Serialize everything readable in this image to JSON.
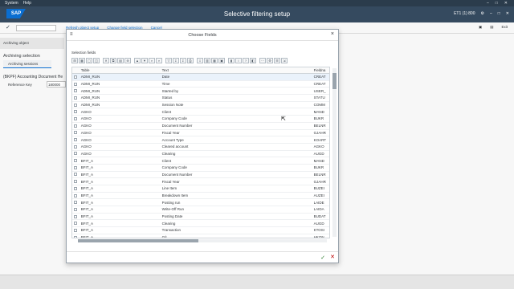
{
  "menubar": {
    "items": [
      "System",
      "Help"
    ]
  },
  "titlebar": {
    "logo": "SAP",
    "title": "Selective filtering setup",
    "system_info": "ET1 (1) 800"
  },
  "toolbar": {
    "links": [
      "Refresh object setup",
      "Change field selection",
      "Cancel"
    ],
    "right": [
      "Exit"
    ]
  },
  "background": {
    "tab": "Archiving object",
    "section": "Archiving selection",
    "subtab": "Archiving sessions",
    "doc": "(BKPF) Accounting Document He",
    "ref_label": "Reference Key",
    "ref_value": "180000"
  },
  "dialog": {
    "title": "Choose Fields",
    "section_label": "Selection fields",
    "columns": {
      "table": "Table",
      "text": "Text",
      "field": "Fieldna"
    },
    "rows": [
      {
        "table": "ADMI_RUN",
        "text": "Date",
        "field": "CREAT"
      },
      {
        "table": "ADMI_RUN",
        "text": "Time",
        "field": "CREAT"
      },
      {
        "table": "ADMI_RUN",
        "text": "Started by",
        "field": "USER_"
      },
      {
        "table": "ADMI_RUN",
        "text": "Status",
        "field": "STATU"
      },
      {
        "table": "ADMI_RUN",
        "text": "Session Note",
        "field": "COMM"
      },
      {
        "table": "AGKO",
        "text": "Client",
        "field": "MAND"
      },
      {
        "table": "AGKO",
        "text": "Company Code",
        "field": "BUKR"
      },
      {
        "table": "AGKO",
        "text": "Document Number",
        "field": "BELNR"
      },
      {
        "table": "AGKO",
        "text": "Fiscal Year",
        "field": "GJAHR"
      },
      {
        "table": "AGKO",
        "text": "Account Type",
        "field": "KOART"
      },
      {
        "table": "AGKO",
        "text": "Cleared account",
        "field": "AGKO"
      },
      {
        "table": "AGKO",
        "text": "Clearing",
        "field": "AUGD"
      },
      {
        "table": "BFIT_A",
        "text": "Client",
        "field": "MAND"
      },
      {
        "table": "BFIT_A",
        "text": "Company Code",
        "field": "BUKR"
      },
      {
        "table": "BFIT_A",
        "text": "Document Number",
        "field": "BELNR"
      },
      {
        "table": "BFIT_A",
        "text": "Fiscal Year",
        "field": "GJAHR"
      },
      {
        "table": "BFIT_A",
        "text": "Line Item",
        "field": "BUZEI"
      },
      {
        "table": "BFIT_A",
        "text": "Breakdown Item",
        "field": "AUZEI"
      },
      {
        "table": "BFIT_A",
        "text": "Posting run",
        "field": "LAIDE"
      },
      {
        "table": "BFIT_A",
        "text": "Write-Off Run",
        "field": "LAIDA"
      },
      {
        "table": "BFIT_A",
        "text": "Posting Date",
        "field": "BUDAT"
      },
      {
        "table": "BFIT_A",
        "text": "Clearing",
        "field": "AUGD"
      },
      {
        "table": "BFIT_A",
        "text": "Transaction",
        "field": "KTOSI"
      },
      {
        "table": "BFIT_A",
        "text": "G/L",
        "field": "HKON"
      }
    ]
  }
}
